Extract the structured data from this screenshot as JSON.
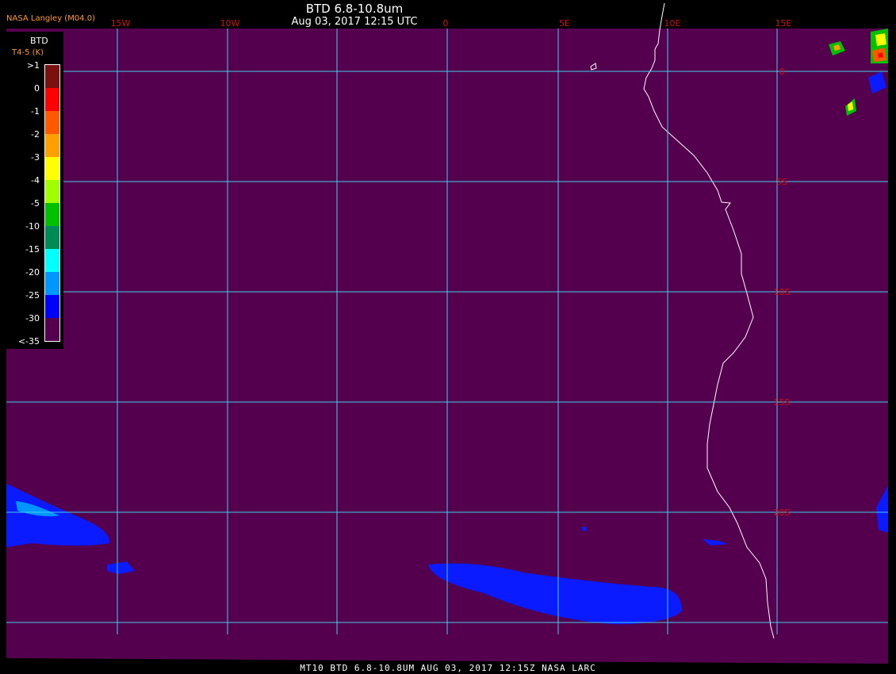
{
  "header": {
    "title": "BTD 6.8-10.8um",
    "datetime": "Aug 03, 2017 12:15 UTC",
    "org": "NASA Langley (M04.0)"
  },
  "legend": {
    "title": "BTD",
    "subtitle": "T4-5 (K)",
    "labels": [
      ">1",
      "0",
      "-1",
      "-2",
      "-3",
      "-4",
      "-5",
      "-10",
      "-15",
      "-20",
      "-25",
      "-30",
      "<-35"
    ],
    "colors": [
      "#7a1010",
      "#ff0000",
      "#ff5a00",
      "#ffa000",
      "#ffff00",
      "#a0ff00",
      "#00c000",
      "#008a55",
      "#00ffff",
      "#0096ff",
      "#0000ff",
      "#55004f"
    ]
  },
  "map": {
    "background": "#55004f",
    "grid_color": "#3fd0e8",
    "label_color": "#cc1111",
    "lon_labels": [
      "15W",
      "10W",
      "0",
      "5E",
      "10E",
      "15E"
    ],
    "lat_labels": [
      "0",
      "5S",
      "10S",
      "15S",
      "20S"
    ],
    "coast_color": "#ffffff"
  },
  "footer": {
    "text": "MT10  BTD 6.8-10.8UM   AUG 03, 2017 12:15Z   NASA LARC"
  }
}
